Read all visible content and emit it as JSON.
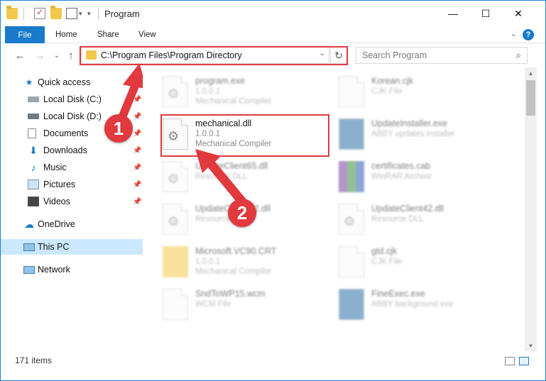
{
  "titlebar": {
    "title": "Program",
    "minimize": "—",
    "maximize": "☐",
    "close": "✕"
  },
  "ribbon": {
    "file": "File",
    "home": "Home",
    "share": "Share",
    "view": "View",
    "help": "?"
  },
  "nav": {
    "back": "←",
    "forward": "→",
    "recent": "⌄",
    "up": "↑",
    "address": "C:\\Program Files\\Program Directory",
    "refresh": "↻",
    "search_placeholder": "Search Program"
  },
  "sidebar": {
    "items": [
      {
        "label": "Quick access",
        "icon": "star-icon"
      },
      {
        "label": "Local Disk (C:)",
        "icon": "drive-icon"
      },
      {
        "label": "Local Disk (D:)",
        "icon": "drive-icon"
      },
      {
        "label": "Documents",
        "icon": "documents-icon"
      },
      {
        "label": "Downloads",
        "icon": "download-icon"
      },
      {
        "label": "Music",
        "icon": "music-icon"
      },
      {
        "label": "Pictures",
        "icon": "pictures-icon"
      },
      {
        "label": "Videos",
        "icon": "videos-icon"
      },
      {
        "label": "OneDrive",
        "icon": "cloud-icon"
      },
      {
        "label": "This PC",
        "icon": "computer-icon"
      },
      {
        "label": "Network",
        "icon": "network-icon"
      }
    ]
  },
  "files": {
    "program_exe": {
      "name": "program.exe",
      "line1": "1.0.0.1",
      "line2": "Mechanical Compiler"
    },
    "korean_cjk": {
      "name": "Korean.cjk",
      "line1": "CJK File",
      "line2": ""
    },
    "mechanical_dll": {
      "name": "mechanical.dll",
      "line1": "1.0.0.1",
      "line2": "Mechanical Compiler"
    },
    "updateinstaller": {
      "name": "UpdateInstaller.exe",
      "line1": "ABBY updates installer",
      "line2": ""
    },
    "updateclient65": {
      "name": "UpdateClient65.dll",
      "line1": "Resource DLL",
      "line2": ""
    },
    "certificates": {
      "name": "certificates.cab",
      "line1": "WinRAR Archive",
      "line2": ""
    },
    "updateclient_x2": {
      "name": "UpdateClient...2.dll",
      "line1": "Resource DLL",
      "line2": ""
    },
    "updateclient42": {
      "name": "UpdateClient42.dll",
      "line1": "Resource DLL",
      "line2": ""
    },
    "microsoft_vc90": {
      "name": "Microsoft.VC90.CRT",
      "line1": "1.0.0.1",
      "line2": "Mechanical Compiler"
    },
    "gtd_cjk": {
      "name": "gtd.cjk",
      "line1": "CJK File",
      "line2": ""
    },
    "sndtowfs": {
      "name": "SndToWP15.wcm",
      "line1": "WCM File",
      "line2": ""
    },
    "fineexec": {
      "name": "FineExec.exe",
      "line1": "ABBY background exe",
      "line2": ""
    }
  },
  "status": {
    "items_count": "171 items"
  },
  "annotations": {
    "badge1": "1",
    "badge2": "2",
    "accent_color": "#e0393e"
  }
}
